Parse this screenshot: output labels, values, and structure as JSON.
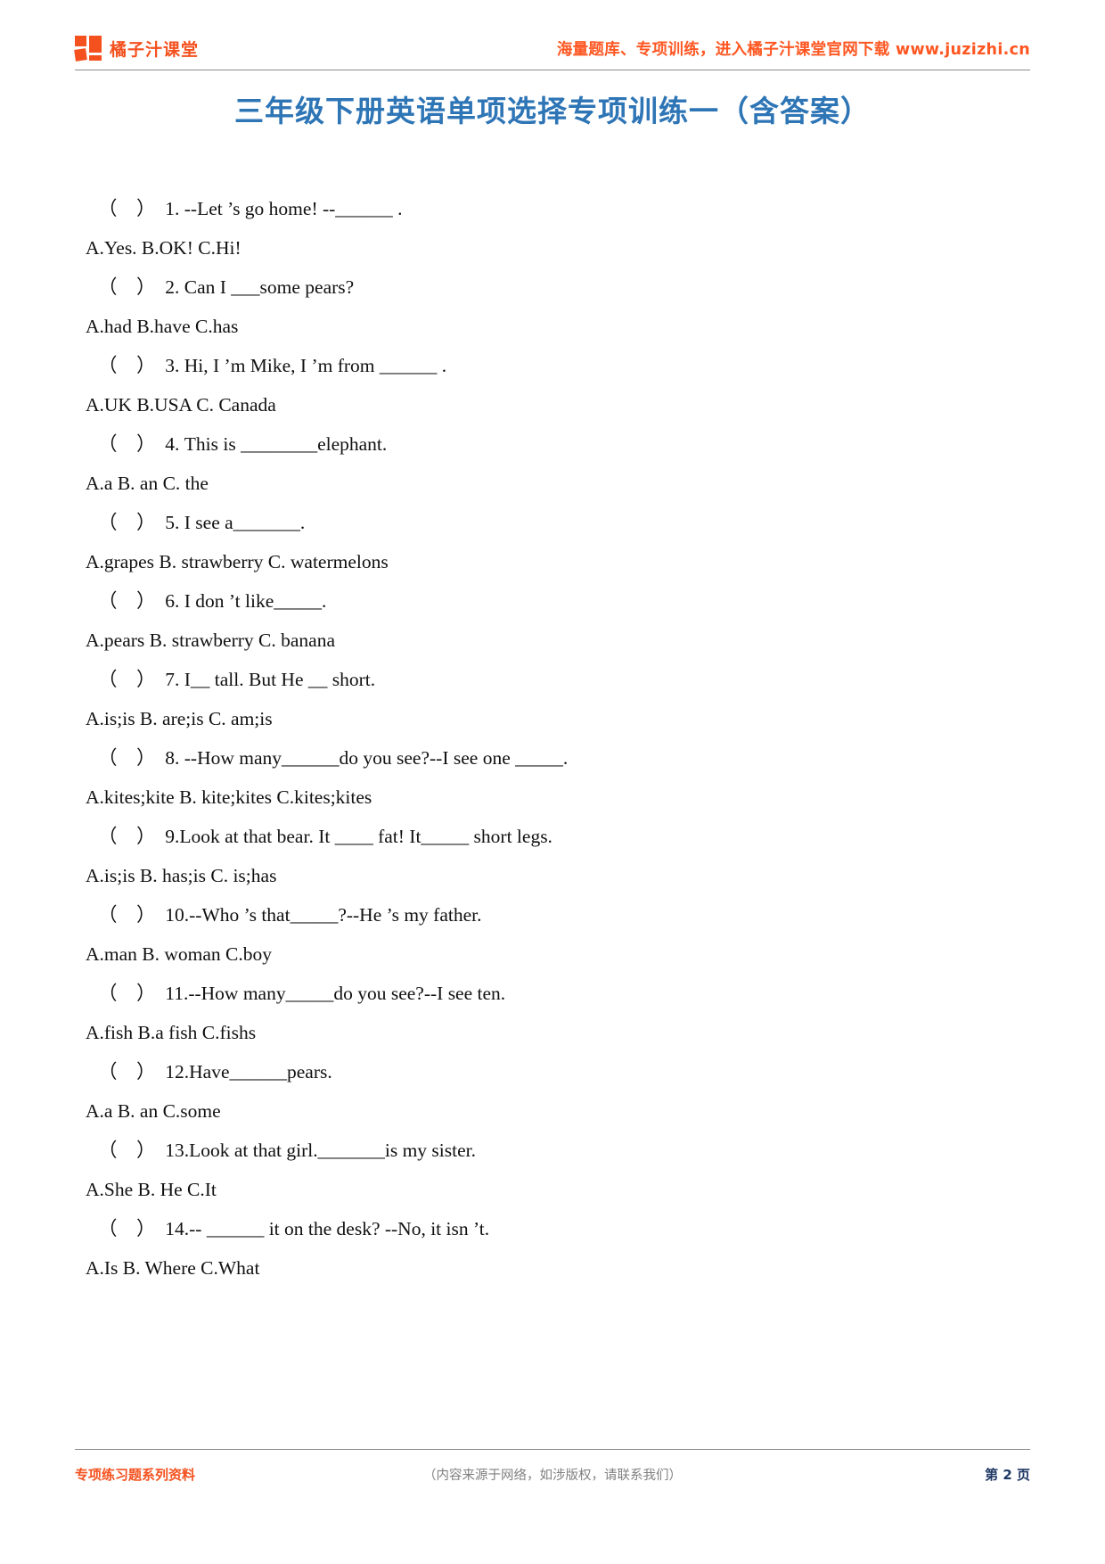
{
  "header": {
    "brand_name": "橘子汁课堂",
    "logo_icon": "four-square-logo-icon",
    "promo_text": "海量题库、专项训练，进入橘子汁课堂官网下载 www.juzizhi.cn",
    "brand_color": "#F4511E"
  },
  "title": "三年级下册英语单项选择专项训练一（含答案）",
  "title_color": "#2E75B6",
  "questions": [
    {
      "stem": "（    ）  1. --Let ’s go home! --______ .",
      "options": "A.Yes. B.OK! C.Hi!"
    },
    {
      "stem": "（    ）  2. Can I ___some pears?",
      "options": "A.had B.have C.has"
    },
    {
      "stem": "（    ）  3. Hi, I ’m Mike, I ’m from ______ .",
      "options": "A.UK B.USA C. Canada"
    },
    {
      "stem": "（    ）  4. This is ________elephant.",
      "options": "A.a B. an C. the"
    },
    {
      "stem": "（    ）  5. I see a_______.",
      "options": "A.grapes B. strawberry C. watermelons"
    },
    {
      "stem": "（    ）  6. I don ’t like_____.",
      "options": "A.pears B. strawberry C. banana"
    },
    {
      "stem": "（    ）  7. I__ tall. But He __ short.",
      "options": "A.is;is B. are;is C. am;is"
    },
    {
      "stem": "（    ）  8. --How many______do you see?--I see one _____.",
      "options": "A.kites;kite B. kite;kites C.kites;kites"
    },
    {
      "stem": "（    ）  9.Look at that bear. It ____ fat! It_____ short legs.",
      "options": "A.is;is B. has;is C. is;has"
    },
    {
      "stem": "（    ）  10.--Who ’s that_____?--He ’s my father.",
      "options": "A.man B. woman C.boy"
    },
    {
      "stem": "（    ）  11.--How many_____do you see?--I see ten.",
      "options": "A.fish B.a fish C.fishs"
    },
    {
      "stem": "（    ）  12.Have______pears.",
      "options": "A.a B. an C.some"
    },
    {
      "stem": "（    ）  13.Look at that girl._______is my sister.",
      "options": "A.She B. He C.It"
    },
    {
      "stem": "（    ）  14.-- ______ it on the desk? --No, it isn ’t.",
      "options": "A.Is B. Where C.What"
    }
  ],
  "footer": {
    "left": "专项练习题系列资料",
    "center": "（内容来源于网络，如涉版权，请联系我们）",
    "page": "第 2 页"
  }
}
